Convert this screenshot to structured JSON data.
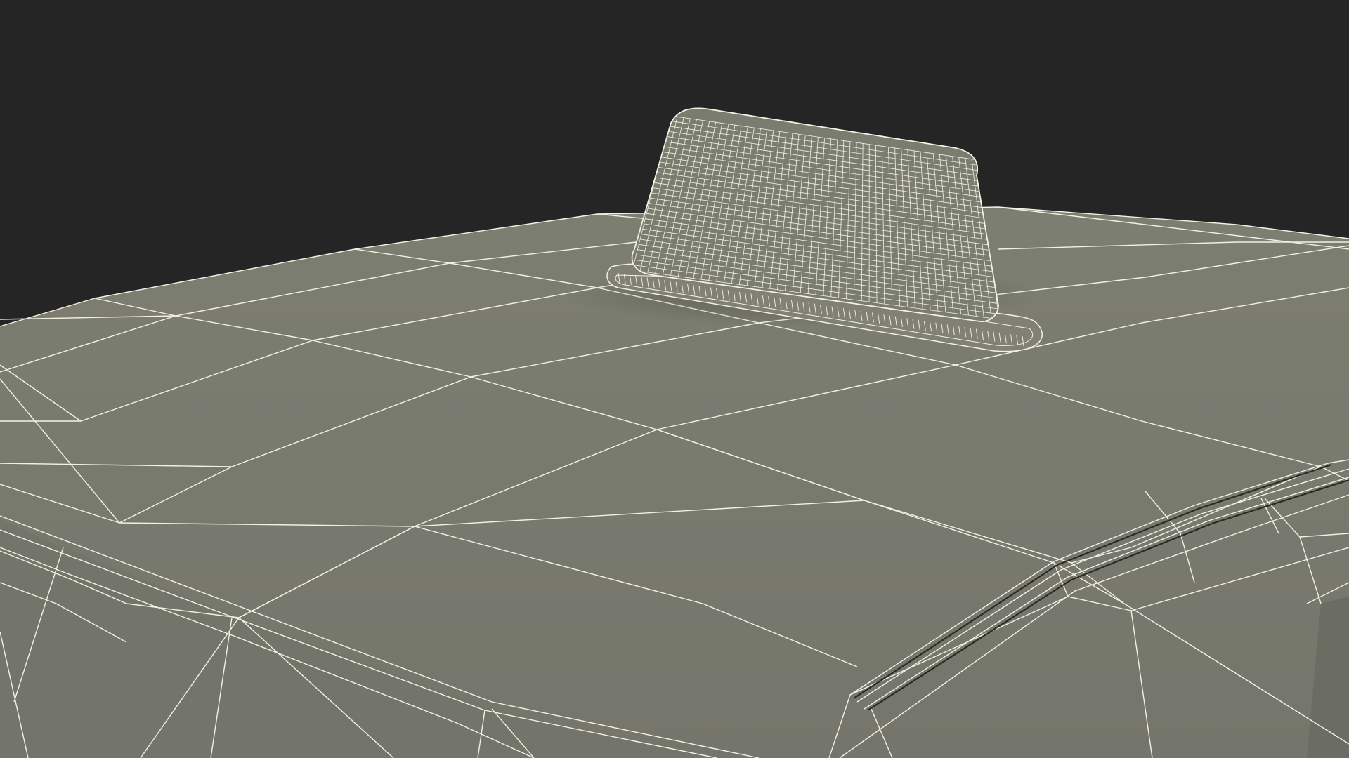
{
  "scene": {
    "background_color": "#252525",
    "surface_color": "#797a6e",
    "surface_shade_color": "#6f7065",
    "wire_color": "#f4f1e4",
    "sign_color": "#7b7c70",
    "gap_color": "#2a2b27"
  }
}
